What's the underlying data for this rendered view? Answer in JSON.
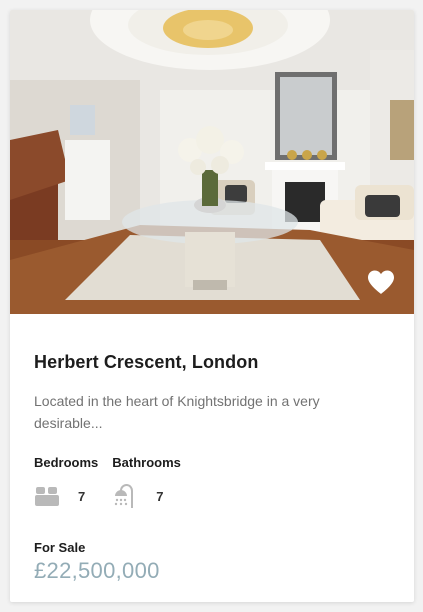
{
  "listing": {
    "title": "Herbert Crescent, London",
    "description": "Located in the heart of Knightsbridge in a very desirable...",
    "bedrooms_label": "Bedrooms",
    "bedrooms_value": "7",
    "bathrooms_label": "Bathrooms",
    "bathrooms_value": "7",
    "status": "For Sale",
    "price": "£22,500,000"
  },
  "icons": {
    "favorite": "heart-icon",
    "bedroom": "bed-icon",
    "bathroom": "shower-icon"
  },
  "colors": {
    "price": "#93acb6",
    "title": "#1d1d1d",
    "description": "#727272"
  }
}
